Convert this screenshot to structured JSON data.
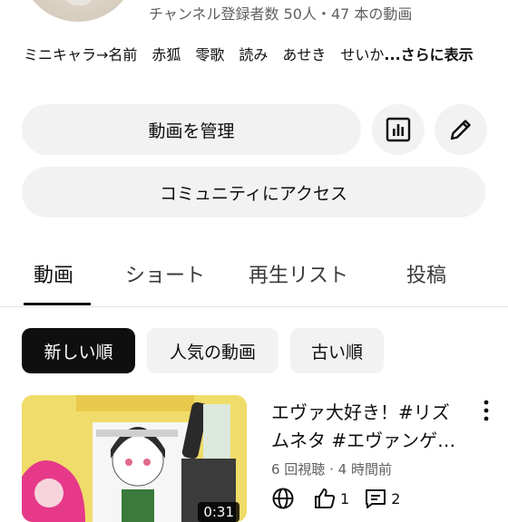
{
  "channel": {
    "stats": "チャンネル登録者数 50人・47 本の動画",
    "description": "ミニキャラ→名前　赤狐　零歌　読み　あせき　せいか",
    "description_more": "...さらに表示"
  },
  "buttons": {
    "manage_videos": "動画を管理",
    "community_access": "コミュニティにアクセス",
    "analytics_icon": "bar-chart-icon",
    "edit_icon": "pencil-icon"
  },
  "tabs": [
    "動画",
    "ショート",
    "再生リスト",
    "投稿"
  ],
  "active_tab": "動画",
  "chips": [
    "新しい順",
    "人気の動画",
    "古い順"
  ],
  "selected_chip": "新しい順",
  "video": {
    "title": "エヴァ大好き！#リズムネタ #エヴァンゲ…",
    "views": "6 回視聴",
    "age": "4 時間前",
    "meta_separator": "·",
    "duration": "0:31",
    "likes": "1",
    "comments": "2"
  }
}
